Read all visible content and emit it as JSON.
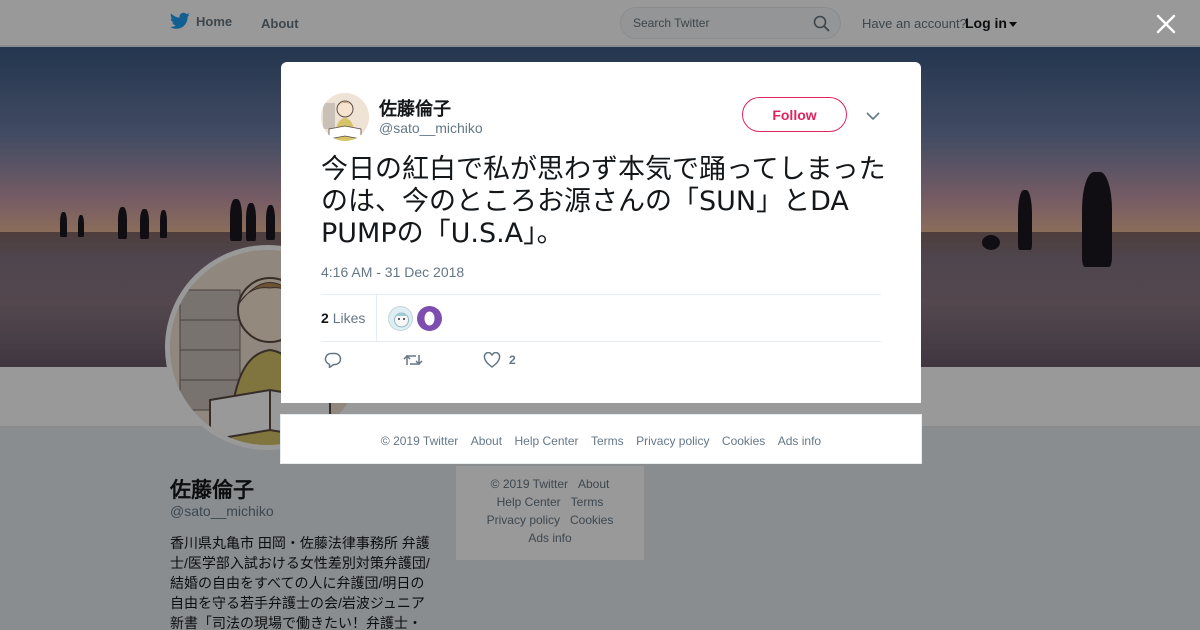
{
  "header": {
    "home_label": "Home",
    "about_label": "About",
    "search_placeholder": "Search Twitter",
    "have_account": "Have an account?",
    "login_label": "Log in"
  },
  "profile": {
    "name": "佐藤倫子",
    "handle": "@sato__michiko",
    "bio": "香川県丸亀市 田岡・佐藤法律事務所 弁護士/医学部入試おける女性差別対策弁護団/結婚の自由をすべての人に弁護団/明日の自由を守る若手弁護士の会/岩波ジュニア新書「司法の現場で働きたい！弁護士・"
  },
  "side_footer": {
    "rows": [
      [
        "© 2019 Twitter",
        "About"
      ],
      [
        "Help Center",
        "Terms"
      ],
      [
        "Privacy policy",
        "Cookies"
      ],
      [
        "Ads info"
      ]
    ]
  },
  "tweet": {
    "author_name": "佐藤倫子",
    "author_handle": "@sato__michiko",
    "follow_label": "Follow",
    "text": "今日の紅白で私が思わず本気で踊ってしまったのは、今のところお源さんの「SUN」とDA PUMPの「U.S.A」。",
    "timestamp": "4:16 AM - 31 Dec 2018",
    "likes_count": "2",
    "likes_label": "Likes",
    "like_action_count": "2"
  },
  "modal_footer": {
    "links": [
      "© 2019 Twitter",
      "About",
      "Help Center",
      "Terms",
      "Privacy policy",
      "Cookies",
      "Ads info"
    ]
  },
  "colors": {
    "brand_blue": "#1da1f2",
    "follow_red": "#e0245e",
    "secondary_text": "#657786"
  },
  "icons": [
    "twitter-bird-icon",
    "search-icon",
    "close-icon",
    "chevron-down-icon",
    "reply-icon",
    "retweet-icon",
    "heart-icon"
  ]
}
